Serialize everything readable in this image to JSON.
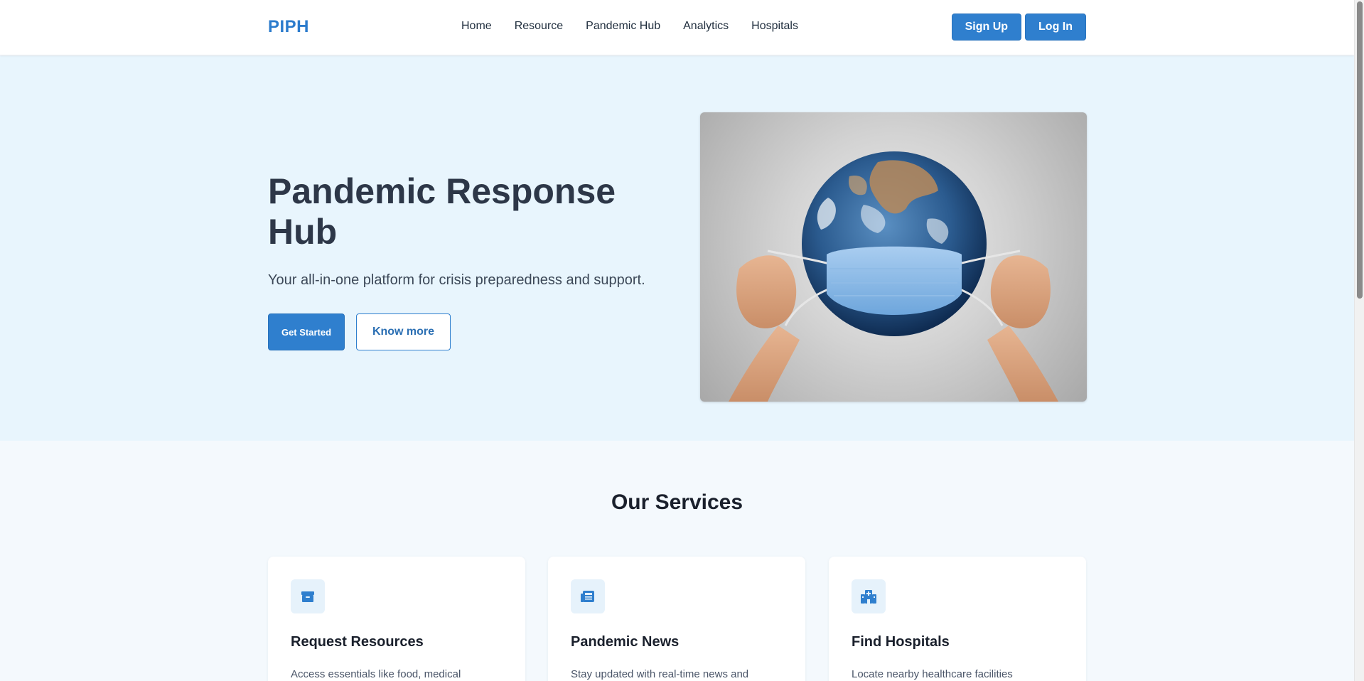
{
  "header": {
    "logo": "PIPH",
    "nav": [
      "Home",
      "Resource",
      "Pandemic Hub",
      "Analytics",
      "Hospitals"
    ],
    "sign_up": "Sign Up",
    "log_in": "Log In"
  },
  "hero": {
    "title": "Pandemic Response Hub",
    "subtitle": "Your all-in-one platform for crisis preparedness and support.",
    "get_started": "Get Started",
    "know_more": "Know more"
  },
  "services": {
    "title": "Our Services",
    "cards": [
      {
        "icon": "box-icon",
        "title": "Request Resources",
        "desc": "Access essentials like food, medical"
      },
      {
        "icon": "newspaper-icon",
        "title": "Pandemic News",
        "desc": "Stay updated with real-time news and"
      },
      {
        "icon": "hospital-icon",
        "title": "Find Hospitals",
        "desc": "Locate nearby healthcare facilities"
      }
    ]
  },
  "colors": {
    "brand": "#2f7fce",
    "hero_bg": "#e8f5fd",
    "page_bg": "#f4f9fd"
  }
}
